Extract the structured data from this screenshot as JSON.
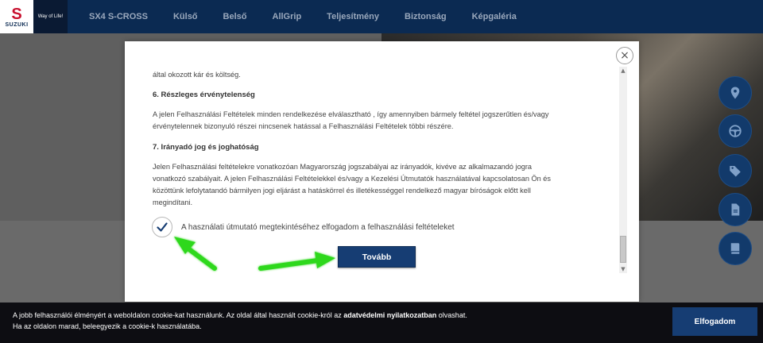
{
  "brand": {
    "logo_text": "SUZUKI",
    "slogan": "Way of Life!"
  },
  "nav": {
    "items": [
      {
        "label": "SX4 S-CROSS"
      },
      {
        "label": "Külső"
      },
      {
        "label": "Belső"
      },
      {
        "label": "AllGrip"
      },
      {
        "label": "Teljesítmény"
      },
      {
        "label": "Biztonság"
      },
      {
        "label": "Képgaléria"
      }
    ]
  },
  "side_icons": [
    "location-icon",
    "steering-wheel-icon",
    "price-tag-icon",
    "document-icon",
    "book-icon"
  ],
  "modal": {
    "close_glyph": "×",
    "line_top": "által okozott kár és költség.",
    "section6_heading": "6. Részleges érvénytelenség",
    "section6_p1": "A jelen Felhasználási Feltételek minden rendelkezése elválasztható , így amennyiben bármely feltétel jogszerűtlen és/vagy",
    "section6_p2": "érvénytelennek bizonyuló részei nincsenek hatással a Felhasználási Feltételek többi részére.",
    "section7_heading": "7. Irányadó jog és joghatóság",
    "section7_p1": "Jelen Felhasználási feltételekre vonatkozóan Magyarország jogszabályai az irányadók, kivéve az alkalmazandó jogra",
    "section7_p2": "vonatkozó szabályait. A jelen Felhasználási Feltételekkel és/vagy a Kezelési Útmutatók használatával kapcsolatosan Ön és",
    "section7_p3": "közöttünk lefolytatandó bármilyen jogi eljárást a hatáskörrel és illetékességgel rendelkező magyar bíróságok előtt kell",
    "section7_p4": "megindítani.",
    "checkbox_checked": true,
    "checkbox_label": "A használati útmutató megtekintéséhez elfogadom a felhasználási feltételeket",
    "next_button": "Tovább"
  },
  "cookie": {
    "line1_pre": "A jobb felhasználói élményért a weboldalon cookie-kat használunk. Az oldal által használt cookie-król az ",
    "line1_link": "adatvédelmi nyilatkozatban",
    "line1_post": " olvashat.",
    "line2": "Ha az oldalon marad, beleegyezik a cookie-k használatába.",
    "accept_button": "Elfogadom"
  },
  "colors": {
    "nav_bg": "#0b2a52",
    "accent_blue": "#163d73",
    "arrow_green": "#3be32a",
    "cookie_bg": "#0d0d12"
  }
}
